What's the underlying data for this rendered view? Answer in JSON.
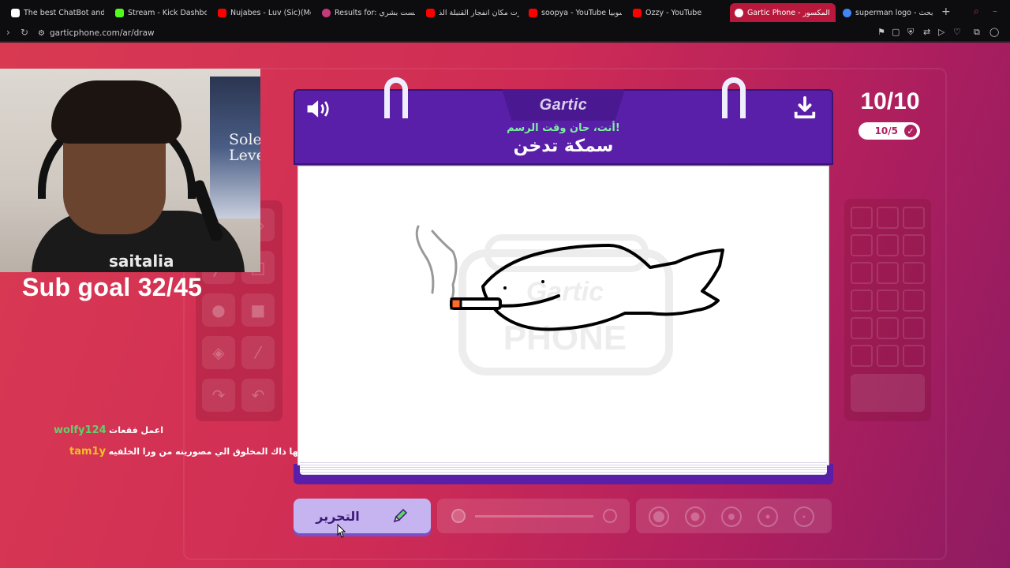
{
  "browser": {
    "tabs": [
      {
        "title": "The best ChatBot and W",
        "favicon_color": "#ffffff"
      },
      {
        "title": "Stream - Kick Dashboar",
        "favicon_color": "#53fc18"
      },
      {
        "title": "Nujabes - Luv (Sic)(Mo",
        "favicon_color": "#ff0000"
      },
      {
        "title": "Results for: لست بشري U",
        "favicon_color": "#c43b7a"
      },
      {
        "title": "زرت مكان انفجار القنبلة الذ",
        "favicon_color": "#ff0000"
      },
      {
        "title": "soopya - YouTube سوبيا",
        "favicon_color": "#ff0000"
      },
      {
        "title": "Ozzy - YouTube",
        "favicon_color": "#ff0000"
      },
      {
        "title": "Gartic Phone - ف المكسور",
        "favicon_color": "#ffffff",
        "active": true
      },
      {
        "title": "superman logo - بحث Go",
        "favicon_color": "#4285f4"
      }
    ],
    "url": "garticphone.com/ar/draw"
  },
  "stream": {
    "sub_goal": "Sub goal 32/45",
    "poster_text": "Sole\nLevel",
    "shirt_text": "saitalia",
    "chat": [
      {
        "user": "wolfy124",
        "user_color": "#5fd36a",
        "message": "اعمل فقعات"
      },
      {
        "user": "tam1y",
        "user_color": "#f0c020",
        "message": "كانها ذاك المخلوق الي مصورينه من ورا الخلفيه ☺"
      }
    ]
  },
  "game": {
    "logo": "Gartic",
    "prompt_sub": "أنت، حان وقت الرسم!",
    "prompt_word": "سمكة تدخن",
    "round": "10/10",
    "round_pill": "10/5",
    "done_button": "التحرير",
    "watermark": "Gartic PHONE",
    "colors": {
      "header": "#5a1fa8",
      "accent_green": "#7ef0a0",
      "button": "#c6b4f0"
    }
  }
}
